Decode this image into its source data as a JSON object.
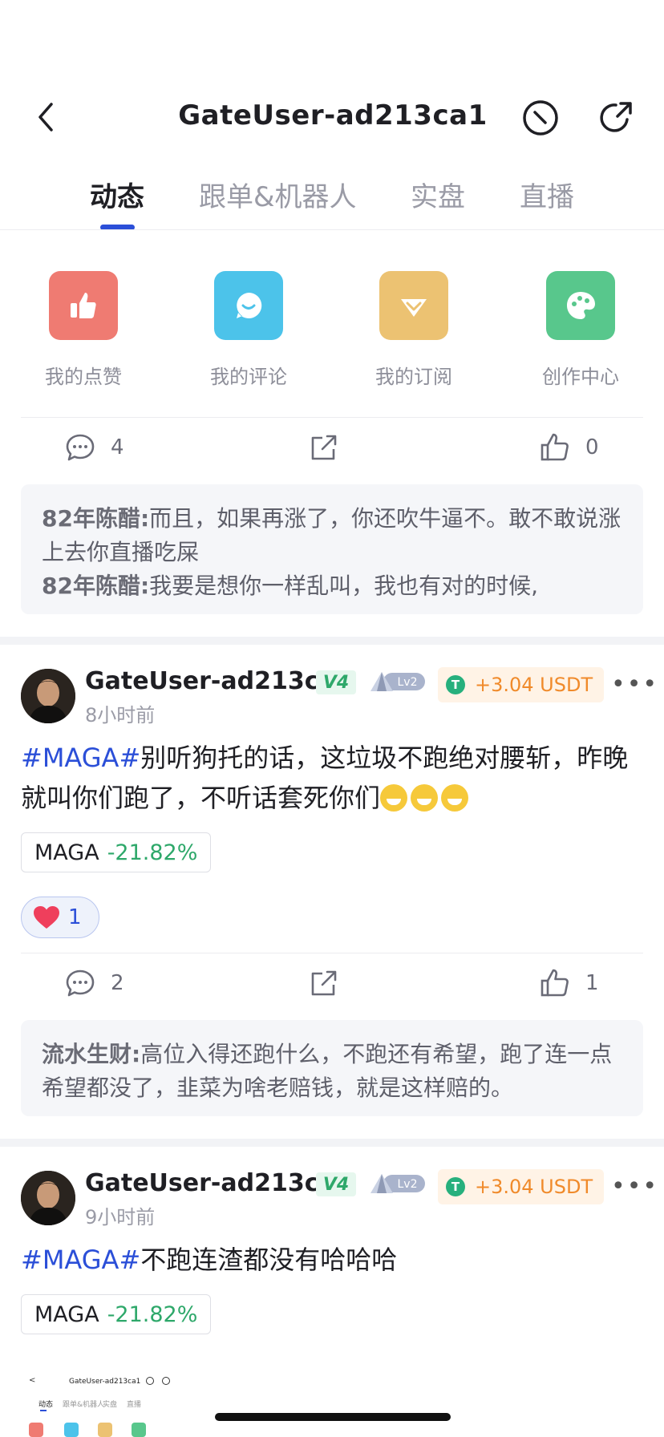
{
  "header": {
    "title": "GateUser-ad213ca1"
  },
  "tabs": [
    {
      "label": "动态",
      "active": true
    },
    {
      "label": "跟单&机器人",
      "active": false
    },
    {
      "label": "实盘",
      "active": false
    },
    {
      "label": "直播",
      "active": false
    }
  ],
  "quick_actions": [
    {
      "label": "我的点赞",
      "color": "#ef7b72",
      "icon": "thumbs-up-icon"
    },
    {
      "label": "我的评论",
      "color": "#4cc3ea",
      "icon": "comment-smile-icon"
    },
    {
      "label": "我的订阅",
      "color": "#ecc272",
      "icon": "diamond-icon"
    },
    {
      "label": "创作中心",
      "color": "#58c78c",
      "icon": "palette-icon"
    }
  ],
  "post0": {
    "comments_count": "4",
    "likes_count": "0",
    "comments": [
      {
        "author": "82年陈醋:",
        "text": "而且，如果再涨了，你还吹牛逼不。敢不敢说涨上去你直播吃屎"
      },
      {
        "author": "82年陈醋:",
        "text": "我要是想你一样乱叫，我也有对的时候,"
      }
    ]
  },
  "post1": {
    "username": "GateUser-ad213c...",
    "vip": "V4",
    "level": "Lv2",
    "reward": "+3.04 USDT",
    "time": "8小时前",
    "tag": "#MAGA#",
    "text": "别听狗托的话，这垃圾不跑绝对腰斩，昨晚就叫你们跑了，不听话套死你们",
    "emoji_count": 3,
    "coin_symbol": "MAGA",
    "coin_change": "-21.82%",
    "reaction_count": "1",
    "comments_count": "2",
    "likes_count": "1",
    "comments": [
      {
        "author": "流水生财:",
        "text": "高位入得还跑什么，不跑还有希望，跑了连一点希望都没了，韭菜为啥老赔钱，就是这样赔的。"
      }
    ]
  },
  "post2": {
    "username": "GateUser-ad213c...",
    "vip": "V4",
    "level": "Lv2",
    "reward": "+3.04 USDT",
    "time": "9小时前",
    "tag": "#MAGA#",
    "text": "不跑连渣都没有哈哈哈",
    "coin_symbol": "MAGA",
    "coin_change": "-21.82%"
  },
  "thumbnail": {
    "title": "GateUser-ad213ca1",
    "tabs": [
      "动态",
      "跟单&机器人",
      "实盘",
      "直播"
    ]
  },
  "colors": {
    "accent": "#2b4fd8",
    "positive": "#2ea86a",
    "reward": "#f08a2a"
  }
}
